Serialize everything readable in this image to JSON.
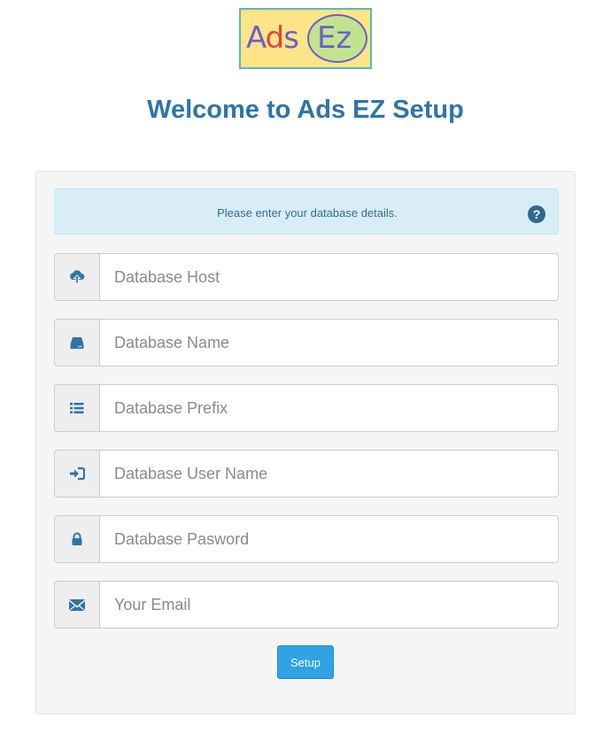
{
  "logo": {
    "part1_a": "A",
    "part1_d": "d",
    "part1_s": "s",
    "part2": "Ez"
  },
  "page_title": "Welcome to Ads EZ Setup",
  "alert": {
    "text": "Please enter your database details.",
    "help": "?"
  },
  "fields": [
    {
      "icon": "cloud-upload-icon",
      "placeholder": "Database Host",
      "value": ""
    },
    {
      "icon": "hard-drive-icon",
      "placeholder": "Database Name",
      "value": ""
    },
    {
      "icon": "list-icon",
      "placeholder": "Database Prefix",
      "value": ""
    },
    {
      "icon": "log-in-icon",
      "placeholder": "Database User Name",
      "value": ""
    },
    {
      "icon": "lock-icon",
      "placeholder": "Database Pasword",
      "value": ""
    },
    {
      "icon": "envelope-icon",
      "placeholder": "Your Email",
      "value": ""
    }
  ],
  "setup_button": "Setup",
  "colors": {
    "accent": "#2f74a9",
    "button": "#2fa3e6",
    "alert_bg": "#d9edf7",
    "panel_bg": "#f5f5f5"
  }
}
